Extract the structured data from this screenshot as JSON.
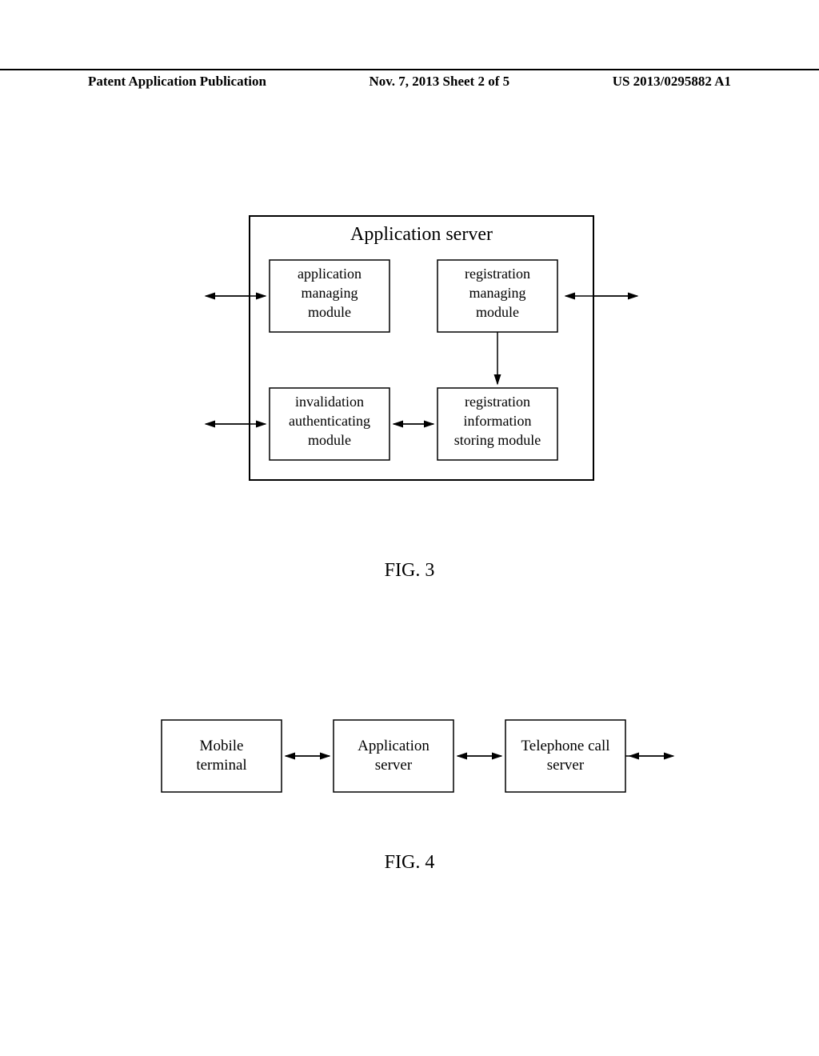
{
  "header": {
    "left": "Patent Application Publication",
    "center": "Nov. 7, 2013  Sheet 2 of 5",
    "right": "US 2013/0295882 A1"
  },
  "fig3": {
    "title": "Application server",
    "box_top_left": {
      "l1": "application",
      "l2": "managing",
      "l3": "module"
    },
    "box_top_right": {
      "l1": "registration",
      "l2": "managing",
      "l3": "module"
    },
    "box_bottom_left": {
      "l1": "invalidation",
      "l2": "authenticating",
      "l3": "module"
    },
    "box_bottom_right": {
      "l1": "registration",
      "l2": "information",
      "l3": "storing module"
    },
    "caption": "FIG. 3"
  },
  "fig4": {
    "box_left": {
      "l1": "Mobile",
      "l2": "terminal"
    },
    "box_center": {
      "l1": "Application",
      "l2": "server"
    },
    "box_right": {
      "l1": "Telephone call",
      "l2": "server"
    },
    "caption": "FIG. 4"
  }
}
